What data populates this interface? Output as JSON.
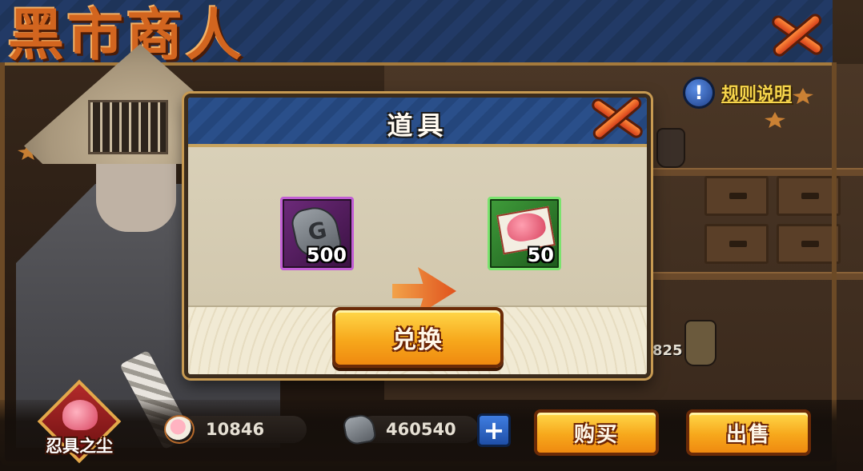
{
  "header": {
    "shop_title": "黑市商人"
  },
  "rules": {
    "label": "规则说明",
    "icon": "exclamation-icon"
  },
  "modal": {
    "title": "道具",
    "cost_item": {
      "icon": "ninja-stone-icon",
      "count": "500",
      "rarity_color": "#c15ed4"
    },
    "reward_item": {
      "icon": "ninja-dust-icon",
      "count": "50",
      "rarity_color": "#7be36f"
    },
    "exchange_label": "兑换",
    "close_icon": "close-x-icon"
  },
  "background": {
    "partial_price": "825"
  },
  "footer": {
    "selected_item_label": "忍具之尘",
    "dust_amount": "10846",
    "stone_amount": "460540",
    "plus_label": "+",
    "buy_label": "购买",
    "sell_label": "出售"
  },
  "colors": {
    "accent_orange": "#f7a81c",
    "header_blue": "#2a4f8a",
    "close_red": "#d5401a"
  }
}
